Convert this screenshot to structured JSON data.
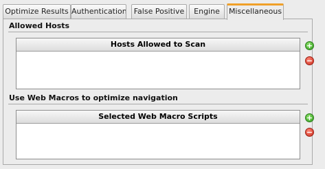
{
  "tabs": [
    {
      "label": "Optimize Results"
    },
    {
      "label": "Authentication"
    },
    {
      "label": "False Positive"
    },
    {
      "label": "Engine"
    },
    {
      "label": "Miscellaneous"
    }
  ],
  "active_tab": "Miscellaneous",
  "allowed_hosts": {
    "title": "Allowed Hosts",
    "list_header": "Hosts Allowed to Scan",
    "add_icon": "plus-icon",
    "remove_icon": "minus-icon"
  },
  "web_macros": {
    "title": "Use Web Macros to optimize navigation",
    "list_header": "Selected Web Macro Scripts",
    "add_icon": "plus-icon",
    "remove_icon": "minus-icon"
  },
  "colors": {
    "accent_active_tab": "#f0a028",
    "add_green": "#2f9a1c",
    "remove_red": "#c92a1a"
  }
}
